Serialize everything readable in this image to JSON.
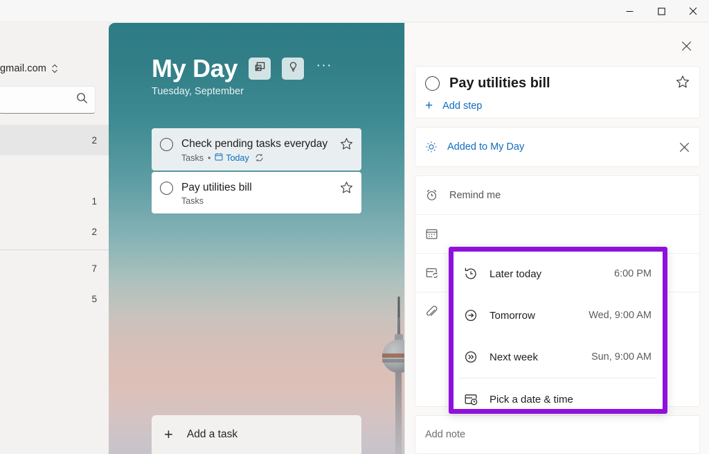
{
  "window": {
    "controls": [
      {
        "name": "minimize",
        "label": "–"
      },
      {
        "name": "maximize",
        "label": "□"
      },
      {
        "name": "close",
        "label": "✕"
      }
    ]
  },
  "sidebar": {
    "account": {
      "email_fragment": "gmail.com",
      "switcher_icon": "chevron-up-down-icon"
    },
    "search": {
      "placeholder": "",
      "value": "",
      "icon": "search-icon"
    },
    "items": [
      {
        "label": "",
        "count": "2",
        "selected": true
      },
      {
        "label": "",
        "count": "",
        "selected": false
      },
      {
        "label": "",
        "count": "1",
        "selected": false
      },
      {
        "label": "",
        "count": "2",
        "selected": false
      }
    ],
    "items_below_divider": [
      {
        "label": "",
        "count": "7"
      },
      {
        "label": "",
        "count": "5"
      }
    ]
  },
  "myday": {
    "title": "My Day",
    "date": "Tuesday, September ",
    "header_buttons": [
      {
        "name": "change-background-button",
        "icon": "picture-icon"
      },
      {
        "name": "suggestions-button",
        "icon": "lightbulb-icon"
      }
    ],
    "more_label": "···",
    "tasks": [
      {
        "title": "Check pending tasks everyday",
        "list": "Tasks",
        "separator": "•",
        "due": "Today",
        "due_icon": "calendar-icon",
        "repeat_icon": "repeat-icon",
        "has_repeat": true,
        "selected": true,
        "star_icon": "star-outline-icon"
      },
      {
        "title": "Pay utilities bill",
        "list": "Tasks",
        "separator": "",
        "due": "",
        "has_repeat": false,
        "selected": false,
        "star_icon": "star-outline-icon"
      }
    ],
    "add_task": {
      "label": "Add a task",
      "plus": "+"
    }
  },
  "detail": {
    "close_icon": "close-icon",
    "task_title": "Pay utilities bill",
    "task_check_icon": "circle-icon",
    "star_icon": "star-outline-icon",
    "add_step": {
      "label": "Add step",
      "plus": "+"
    },
    "added_to_my_day": {
      "label": "Added to My Day",
      "icon": "sun-icon",
      "remove_icon": "close-icon"
    },
    "properties": [
      {
        "name": "remind-me",
        "label": "Remind me",
        "icon": "alarm-clock-icon"
      },
      {
        "name": "add-due-date",
        "label": "",
        "icon": "calendar-icon"
      },
      {
        "name": "repeat",
        "label": "",
        "icon": "calendar-repeat-icon"
      },
      {
        "name": "add-file",
        "label": "",
        "icon": "paperclip-icon"
      }
    ],
    "note": {
      "placeholder": "Add note"
    }
  },
  "reminder_flyout": {
    "highlight_color": "#8f10dd",
    "options": [
      {
        "label": "Later today",
        "value": "6:00 PM",
        "icon": "clock-later-icon"
      },
      {
        "label": "Tomorrow",
        "value": "Wed, 9:00 AM",
        "icon": "arrow-right-circle-icon"
      },
      {
        "label": "Next week",
        "value": "Sun, 9:00 AM",
        "icon": "double-chevron-circle-icon"
      },
      {
        "label": "Pick a date & time",
        "value": "",
        "icon": "calendar-clock-icon"
      }
    ]
  }
}
